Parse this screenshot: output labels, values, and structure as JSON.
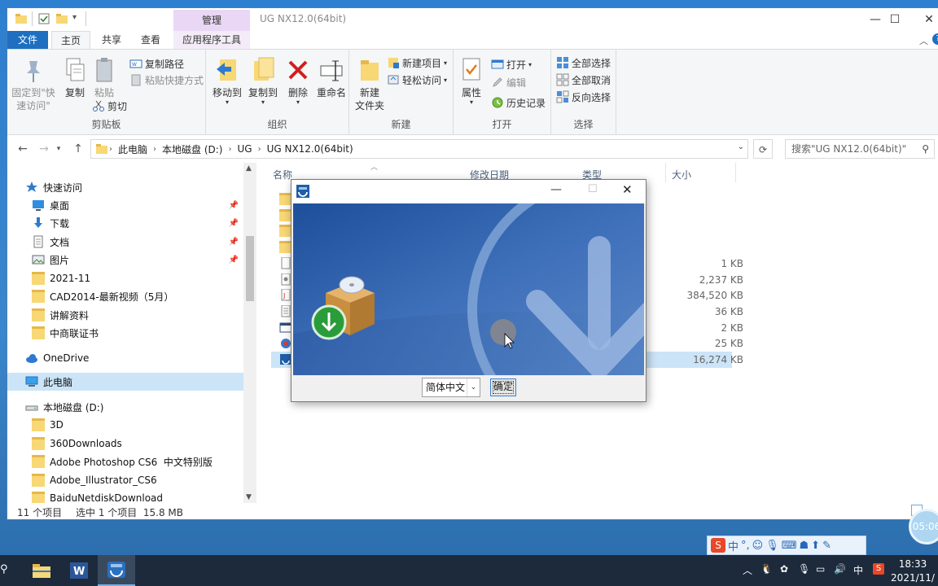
{
  "window": {
    "title": "UG NX12.0(64bit)",
    "context_tab": "管理"
  },
  "tabs": {
    "file": "文件",
    "home": "主页",
    "share": "共享",
    "view": "查看",
    "apptools": "应用程序工具"
  },
  "ribbon": {
    "clipboard": {
      "label": "剪贴板",
      "pin": "固定到\"快\n速访问\"",
      "pin1": "固定到\"快",
      "pin2": "速访问\"",
      "copy": "复制",
      "paste": "粘贴",
      "copy_path": "复制路径",
      "paste_shortcut": "粘贴快捷方式",
      "cut": "剪切"
    },
    "organize": {
      "label": "组织",
      "move_to": "移动到",
      "copy_to": "复制到",
      "delete": "删除",
      "rename": "重命名"
    },
    "new": {
      "label": "新建",
      "new_folder1": "新建",
      "new_folder2": "文件夹",
      "new_item": "新建项目",
      "easy_access": "轻松访问"
    },
    "open": {
      "label": "打开",
      "properties": "属性",
      "open": "打开",
      "edit": "编辑",
      "history": "历史记录"
    },
    "select": {
      "label": "选择",
      "select_all": "全部选择",
      "select_none": "全部取消",
      "invert": "反向选择"
    }
  },
  "address": {
    "crumbs": [
      "此电脑",
      "本地磁盘 (D:)",
      "UG",
      "UG NX12.0(64bit)"
    ],
    "search_placeholder": "搜索\"UG NX12.0(64bit)\""
  },
  "nav": {
    "quick_access": "快速访问",
    "desktop": "桌面",
    "downloads": "下载",
    "documents": "文档",
    "pictures": "图片",
    "f2021": "2021-11",
    "cad": "CAD2014-最新视频（5月）",
    "lecture": "讲解资料",
    "zhongshang": "中商联证书",
    "onedrive": "OneDrive",
    "thispc": "此电脑",
    "disk_d": "本地磁盘 (D:)",
    "d3d": "3D",
    "d360": "360Downloads",
    "dps": "Adobe Photoshop CS6  中文特别版",
    "dai": "Adobe_Illustrator_CS6",
    "dbaidu": "BaiduNetdiskDownload"
  },
  "columns": {
    "name": "名称",
    "modified": "修改日期",
    "type": "类型",
    "size": "大小"
  },
  "files": {
    "sizes": [
      "1 KB",
      "2,237 KB",
      "384,520 KB",
      "36 KB",
      "2 KB",
      "25 KB",
      "16,274 KB"
    ]
  },
  "status": {
    "count": "11 个项目",
    "selected": "选中 1 个项目  15.8 MB"
  },
  "dialog": {
    "language": "简体中文",
    "ok": "确定"
  },
  "ime": {
    "mode": "中"
  },
  "taskbar": {
    "ime_indicator": "中",
    "time": "18:33",
    "date": "2021/11/",
    "timer_bubble": "05:06"
  },
  "colors": {
    "accent": "#1e6fc0",
    "context_tab": "#e9d7f5",
    "taskbar": "#1d2a3c",
    "folder": "#f8d775"
  }
}
